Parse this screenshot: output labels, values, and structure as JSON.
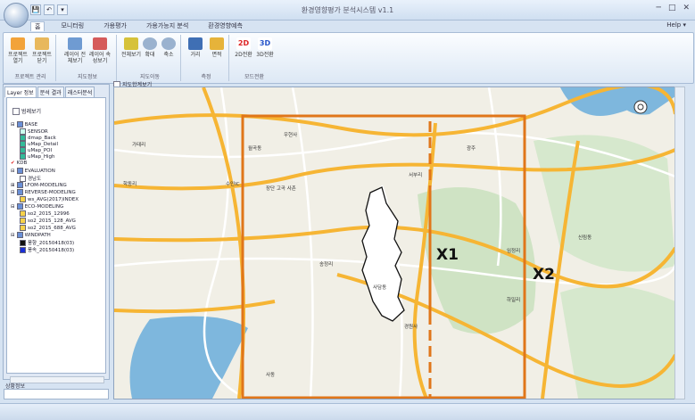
{
  "window": {
    "title": "환경영향평가 분석시스템 v1.1",
    "controls": [
      "─",
      "□",
      "✕"
    ]
  },
  "quick_access": [
    "💾",
    "↶",
    "▾"
  ],
  "ribbon": {
    "tabs": [
      "홈",
      "모니터링",
      "가용평가",
      "가용가능지 분석",
      "환경영향예측"
    ],
    "active_tab": 0,
    "help": "Help ▾",
    "groups": [
      {
        "label": "프로젝트 관리",
        "buttons": [
          "프로젝트 열기",
          "프로젝트 닫기"
        ]
      },
      {
        "label": "지도정보",
        "buttons": [
          "레이어 전체보기",
          "레이어 속성보기"
        ]
      },
      {
        "label": "지도이동",
        "buttons": [
          "전체보기",
          "확대",
          "축소"
        ]
      },
      {
        "label": "측정",
        "buttons": [
          "거리",
          "면적"
        ]
      },
      {
        "label": "모드전환",
        "buttons": [
          "2D전환",
          "3D전환"
        ]
      }
    ],
    "mode_icons": [
      "2D",
      "3D"
    ]
  },
  "left_panel": {
    "tabs": [
      "Layer 정보",
      "분석 결과",
      "래스터분석"
    ],
    "legend_toggle": "범례보기",
    "tree": [
      {
        "text": "BASE",
        "level": 0
      },
      {
        "text": "SENSOR",
        "level": 1
      },
      {
        "text": "dmap_Back",
        "level": 1
      },
      {
        "text": "uMap_Detail",
        "level": 1
      },
      {
        "text": "uMap_POI",
        "level": 1
      },
      {
        "text": "uMap_High",
        "level": 1
      },
      {
        "text": "KDB",
        "level": 0
      },
      {
        "text": "EVALUATION",
        "level": 0
      },
      {
        "text": "경남도",
        "level": 1
      },
      {
        "text": "LFOM-MODELING",
        "level": 0
      },
      {
        "text": "REVERSE-MODELING",
        "level": 0
      },
      {
        "text": "ws_AVG(2017)INDEX",
        "level": 1
      },
      {
        "text": "ECO-MODELING",
        "level": 0
      },
      {
        "text": "so2_2015_12996",
        "level": 1
      },
      {
        "text": "so2_2015_128_AVG",
        "level": 1
      },
      {
        "text": "so2_2015_688_AVG",
        "level": 1
      },
      {
        "text": "WINDPATH",
        "level": 0
      },
      {
        "text": "풍향_20150418(03)",
        "level": 1
      },
      {
        "text": "풍속_20150418(03)",
        "level": 1
      }
    ],
    "status_label": "상황정보"
  },
  "map": {
    "toggle": "지도합계보기",
    "annotations": {
      "x1": "X1",
      "x2": "X2"
    },
    "labels": [
      "우현사",
      "월곡동",
      "가태리",
      "학동리",
      "수인IC",
      "송정리",
      "사담동",
      "경원사",
      "하일리",
      "신림동",
      "광주",
      "장단 고곡 사촌",
      "임정리",
      "서부리",
      "사동"
    ],
    "colors": {
      "highway": "#f6b534",
      "road": "#ffffff",
      "water": "#7eb7dd",
      "green": "#cfe3c4",
      "box": "#e0761a"
    }
  }
}
